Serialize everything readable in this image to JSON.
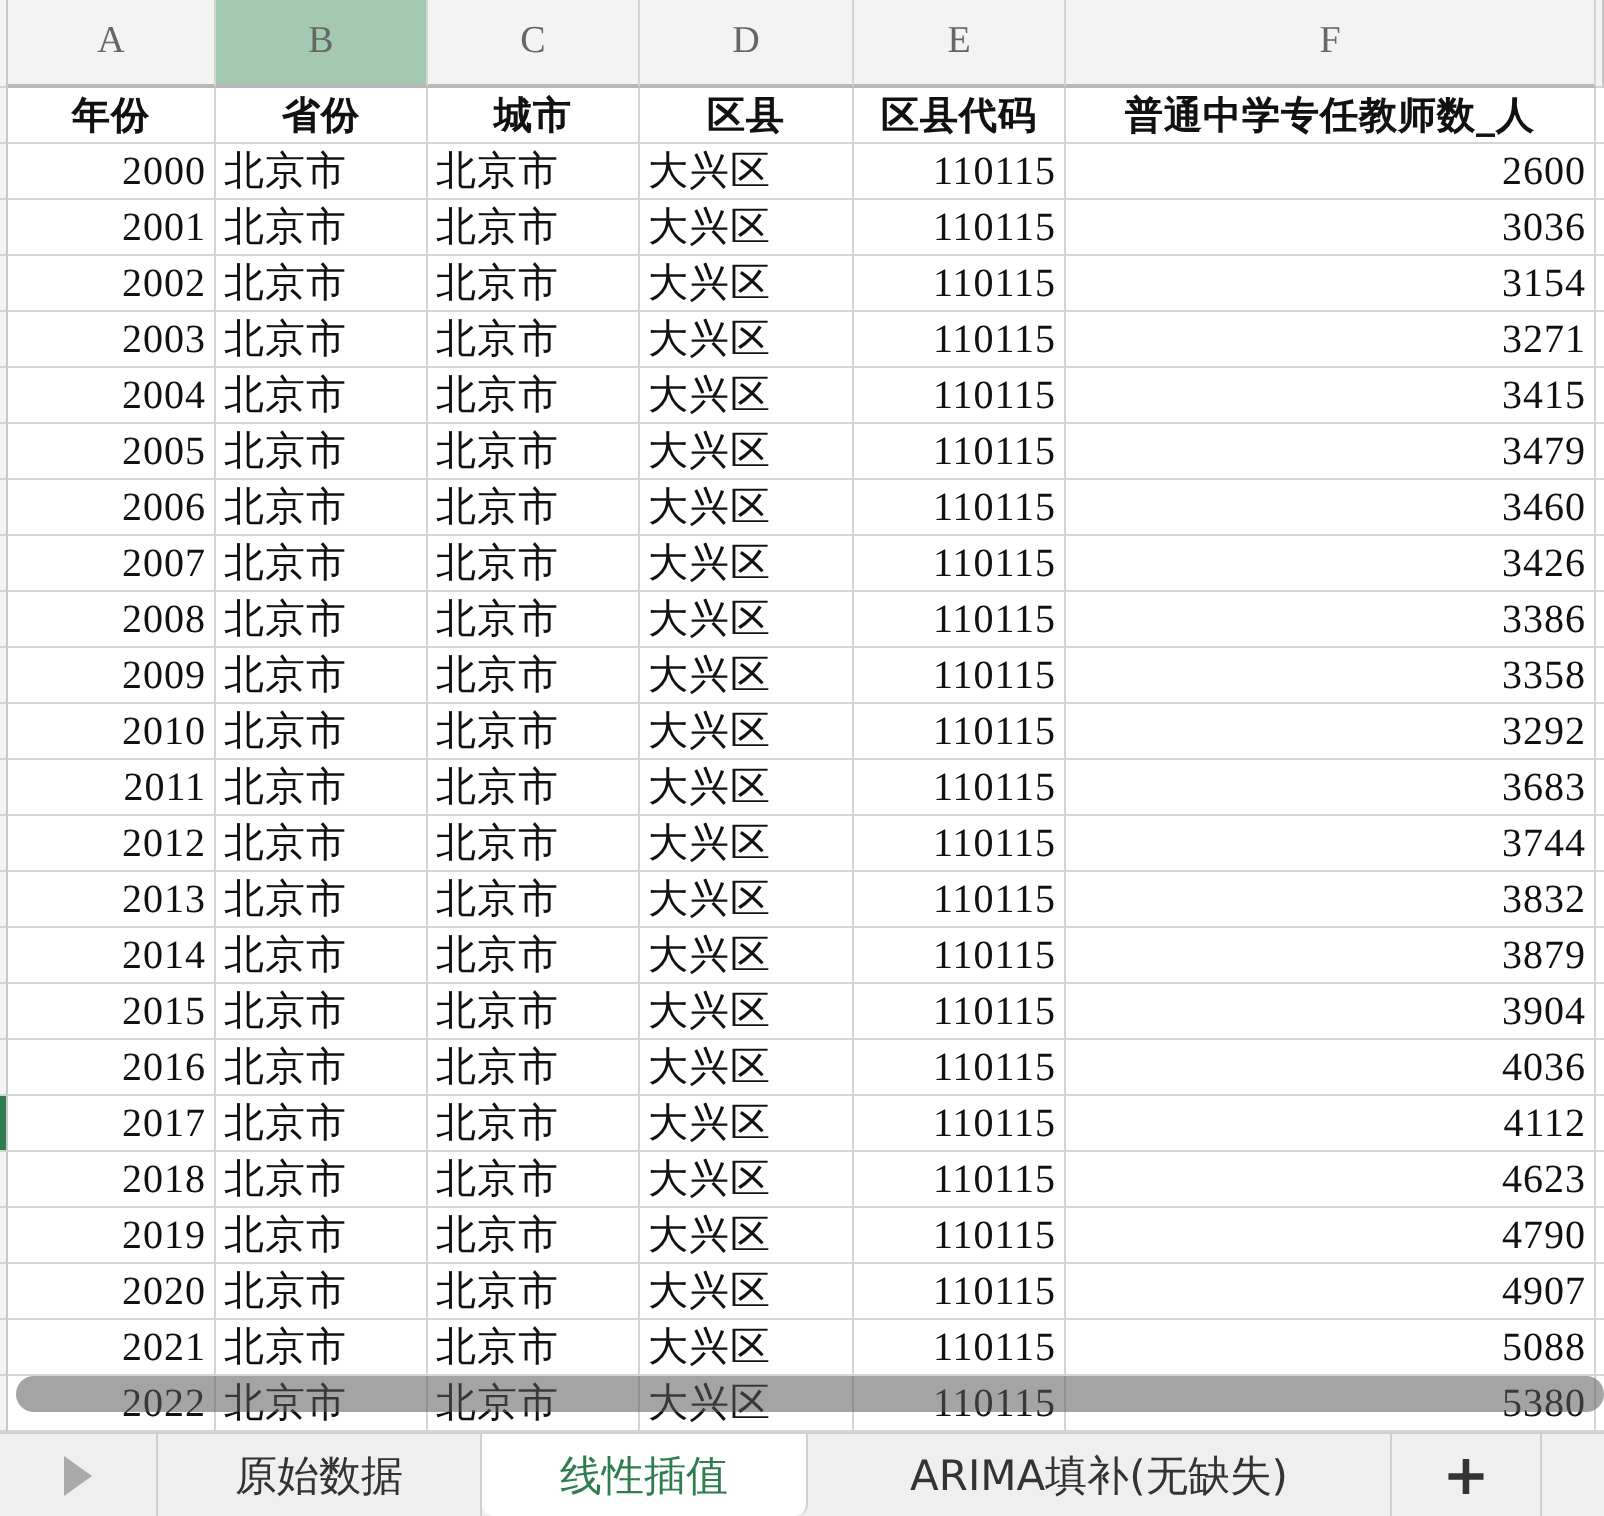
{
  "columns": [
    {
      "letter": "A",
      "selected": false
    },
    {
      "letter": "B",
      "selected": true
    },
    {
      "letter": "C",
      "selected": false
    },
    {
      "letter": "D",
      "selected": false
    },
    {
      "letter": "E",
      "selected": false
    },
    {
      "letter": "F",
      "selected": false
    }
  ],
  "header": [
    "年份",
    "省份",
    "城市",
    "区县",
    "区县代码",
    "普通中学专任教师数_人"
  ],
  "rows": [
    {
      "selected": false,
      "cells": [
        "2000",
        "北京市",
        "北京市",
        "大兴区",
        "110115",
        "2600"
      ]
    },
    {
      "selected": false,
      "cells": [
        "2001",
        "北京市",
        "北京市",
        "大兴区",
        "110115",
        "3036"
      ]
    },
    {
      "selected": false,
      "cells": [
        "2002",
        "北京市",
        "北京市",
        "大兴区",
        "110115",
        "3154"
      ]
    },
    {
      "selected": false,
      "cells": [
        "2003",
        "北京市",
        "北京市",
        "大兴区",
        "110115",
        "3271"
      ]
    },
    {
      "selected": false,
      "cells": [
        "2004",
        "北京市",
        "北京市",
        "大兴区",
        "110115",
        "3415"
      ]
    },
    {
      "selected": false,
      "cells": [
        "2005",
        "北京市",
        "北京市",
        "大兴区",
        "110115",
        "3479"
      ]
    },
    {
      "selected": false,
      "cells": [
        "2006",
        "北京市",
        "北京市",
        "大兴区",
        "110115",
        "3460"
      ]
    },
    {
      "selected": false,
      "cells": [
        "2007",
        "北京市",
        "北京市",
        "大兴区",
        "110115",
        "3426"
      ]
    },
    {
      "selected": false,
      "cells": [
        "2008",
        "北京市",
        "北京市",
        "大兴区",
        "110115",
        "3386"
      ]
    },
    {
      "selected": false,
      "cells": [
        "2009",
        "北京市",
        "北京市",
        "大兴区",
        "110115",
        "3358"
      ]
    },
    {
      "selected": false,
      "cells": [
        "2010",
        "北京市",
        "北京市",
        "大兴区",
        "110115",
        "3292"
      ]
    },
    {
      "selected": false,
      "cells": [
        "2011",
        "北京市",
        "北京市",
        "大兴区",
        "110115",
        "3683"
      ]
    },
    {
      "selected": false,
      "cells": [
        "2012",
        "北京市",
        "北京市",
        "大兴区",
        "110115",
        "3744"
      ]
    },
    {
      "selected": false,
      "cells": [
        "2013",
        "北京市",
        "北京市",
        "大兴区",
        "110115",
        "3832"
      ]
    },
    {
      "selected": false,
      "cells": [
        "2014",
        "北京市",
        "北京市",
        "大兴区",
        "110115",
        "3879"
      ]
    },
    {
      "selected": false,
      "cells": [
        "2015",
        "北京市",
        "北京市",
        "大兴区",
        "110115",
        "3904"
      ]
    },
    {
      "selected": false,
      "cells": [
        "2016",
        "北京市",
        "北京市",
        "大兴区",
        "110115",
        "4036"
      ]
    },
    {
      "selected": true,
      "cells": [
        "2017",
        "北京市",
        "北京市",
        "大兴区",
        "110115",
        "4112"
      ]
    },
    {
      "selected": false,
      "cells": [
        "2018",
        "北京市",
        "北京市",
        "大兴区",
        "110115",
        "4623"
      ]
    },
    {
      "selected": false,
      "cells": [
        "2019",
        "北京市",
        "北京市",
        "大兴区",
        "110115",
        "4790"
      ]
    },
    {
      "selected": false,
      "cells": [
        "2020",
        "北京市",
        "北京市",
        "大兴区",
        "110115",
        "4907"
      ]
    },
    {
      "selected": false,
      "cells": [
        "2021",
        "北京市",
        "北京市",
        "大兴区",
        "110115",
        "5088"
      ]
    },
    {
      "selected": false,
      "cells": [
        "2022",
        "北京市",
        "北京市",
        "大兴区",
        "110115",
        "5380"
      ]
    }
  ],
  "sheet_tabs": [
    {
      "label": "原始数据",
      "selected": false
    },
    {
      "label": "线性插值",
      "selected": true
    },
    {
      "label": "ARIMA填补(无缺失)",
      "selected": false
    }
  ],
  "add_sheet": "+"
}
